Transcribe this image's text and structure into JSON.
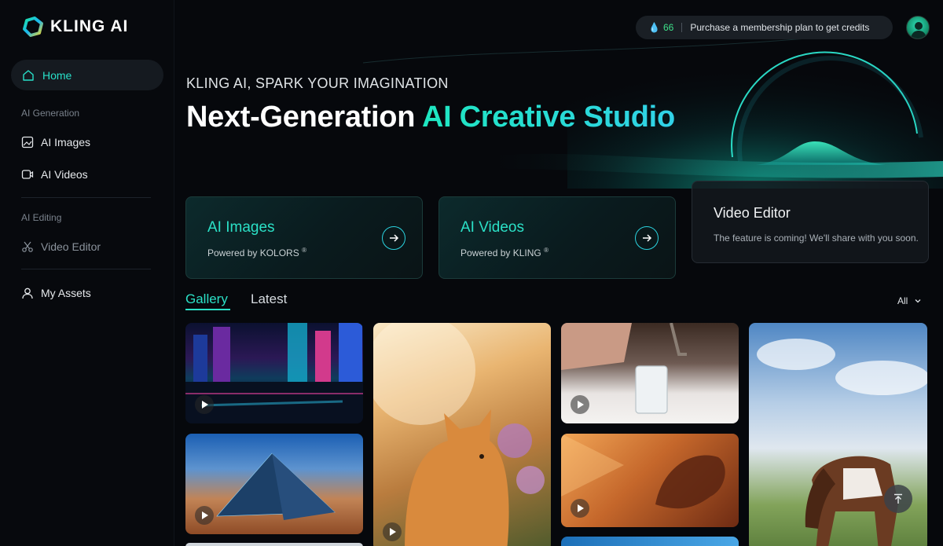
{
  "brand": {
    "name": "KLING AI"
  },
  "sidebar": {
    "home_label": "Home",
    "section_generation": "AI Generation",
    "ai_images_label": "AI Images",
    "ai_videos_label": "AI Videos",
    "section_editing": "AI Editing",
    "video_editor_label": "Video Editor",
    "my_assets_label": "My Assets"
  },
  "topbar": {
    "credits_count": "66",
    "credits_message": "Purchase a membership plan to get credits"
  },
  "hero": {
    "subtitle": "KLING AI, SPARK YOUR IMAGINATION",
    "title_plain": "Next-Generation ",
    "title_accent": "AI Creative Studio"
  },
  "cards": [
    {
      "title": "AI Images",
      "subtitle": "Powered by KOLORS",
      "mark": "®"
    },
    {
      "title": "AI Videos",
      "subtitle": "Powered by KLING",
      "mark": "®"
    }
  ],
  "coming_card": {
    "title": "Video Editor",
    "description": "The feature is coming! We'll share with you soon."
  },
  "tabs": {
    "gallery": "Gallery",
    "latest": "Latest"
  },
  "filter": {
    "selected": "All"
  },
  "colors": {
    "accent": "#2be0c6",
    "background": "#06080c"
  }
}
